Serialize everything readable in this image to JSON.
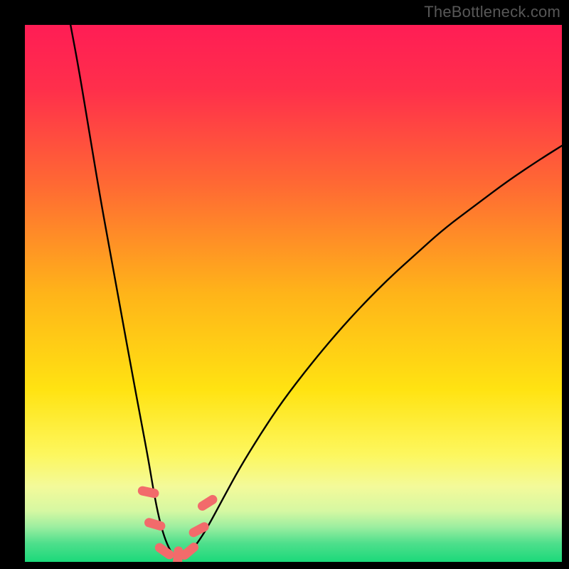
{
  "watermark": "TheBottleneck.com",
  "chart_data": {
    "type": "line",
    "title": "",
    "xlabel": "",
    "ylabel": "",
    "xlim": [
      0,
      100
    ],
    "ylim": [
      0,
      100
    ],
    "grid": false,
    "legend": false,
    "gradient_stops": [
      {
        "offset": 0.0,
        "color": "#ff1d55"
      },
      {
        "offset": 0.12,
        "color": "#ff2f4b"
      },
      {
        "offset": 0.3,
        "color": "#ff6a33"
      },
      {
        "offset": 0.5,
        "color": "#ffb419"
      },
      {
        "offset": 0.68,
        "color": "#ffe312"
      },
      {
        "offset": 0.8,
        "color": "#fdf75e"
      },
      {
        "offset": 0.86,
        "color": "#f3fa9a"
      },
      {
        "offset": 0.905,
        "color": "#d6f8a2"
      },
      {
        "offset": 0.935,
        "color": "#9ceea0"
      },
      {
        "offset": 0.965,
        "color": "#4fdf8c"
      },
      {
        "offset": 1.0,
        "color": "#1bd97a"
      }
    ],
    "series": [
      {
        "name": "bottleneck-curve",
        "color": "#000000",
        "x": [
          8.5,
          10,
          12,
          14,
          16,
          18,
          20,
          21.5,
          23,
          24,
          25,
          26,
          27,
          27.8,
          28.5,
          29.2,
          30.5,
          32,
          34,
          37,
          40,
          44,
          48,
          53,
          58,
          63,
          68,
          73,
          78,
          84,
          90,
          96,
          100
        ],
        "y": [
          100,
          92,
          80,
          68,
          57,
          46,
          35,
          27,
          19,
          13,
          8,
          4.5,
          2.2,
          1.1,
          0.8,
          0.9,
          1.6,
          3.3,
          6.4,
          12,
          17.5,
          24,
          30,
          36.5,
          42.5,
          48,
          53,
          57.5,
          62,
          66.5,
          71,
          75,
          77.5
        ]
      }
    ],
    "markers": {
      "name": "highlight-pills",
      "color": "#f26b6b",
      "points": [
        {
          "x": 23.0,
          "y": 13.0,
          "angle": -78
        },
        {
          "x": 24.2,
          "y": 7.0,
          "angle": -74
        },
        {
          "x": 26.0,
          "y": 2.0,
          "angle": -55
        },
        {
          "x": 28.5,
          "y": 0.9,
          "angle": 5
        },
        {
          "x": 30.6,
          "y": 2.0,
          "angle": 50
        },
        {
          "x": 32.4,
          "y": 6.0,
          "angle": 62
        },
        {
          "x": 34.0,
          "y": 11.0,
          "angle": 58
        }
      ]
    }
  }
}
